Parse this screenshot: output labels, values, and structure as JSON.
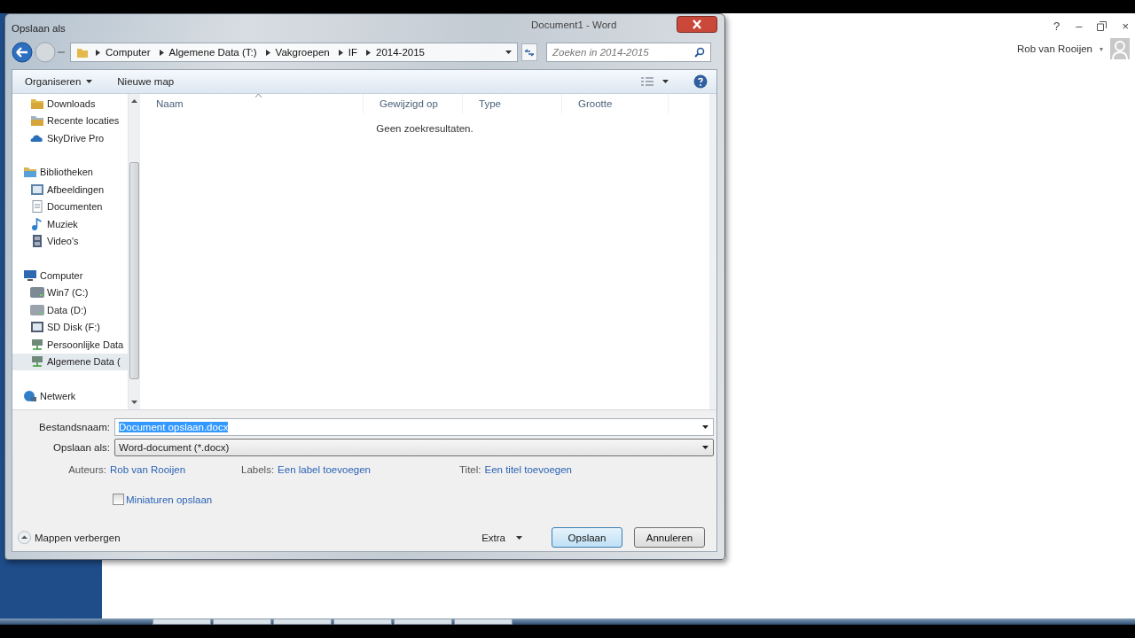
{
  "word_window": {
    "help": "?",
    "minimize": "–",
    "close": "×",
    "user": "Rob van Rooijen",
    "user_caret": "▾"
  },
  "dialog": {
    "title": "Opslaan als",
    "app_title": "Document1 - Word",
    "breadcrumbs": [
      "Computer",
      "Algemene Data (T:)",
      "Vakgroepen",
      "IF",
      "2014-2015"
    ],
    "search": {
      "placeholder": "Zoeken in 2014-2015"
    },
    "toolbar": {
      "organize": "Organiseren",
      "new_folder": "Nieuwe map"
    },
    "nav": [
      {
        "children": [
          {
            "label": "Downloads",
            "kind": "folder",
            "selected": false
          },
          {
            "label": "Recente locaties",
            "kind": "recent",
            "selected": false
          },
          {
            "label": "SkyDrive Pro",
            "kind": "cloud",
            "selected": false
          }
        ]
      },
      {
        "label": "Bibliotheken",
        "kind": "library",
        "selected": false,
        "children": [
          {
            "label": "Afbeeldingen",
            "kind": "pictures",
            "selected": false
          },
          {
            "label": "Documenten",
            "kind": "documents",
            "selected": false
          },
          {
            "label": "Muziek",
            "kind": "music",
            "selected": false
          },
          {
            "label": "Video's",
            "kind": "videos",
            "selected": false
          }
        ]
      },
      {
        "label": "Computer",
        "kind": "computer",
        "selected": false,
        "children": [
          {
            "label": "Win7 (C:)",
            "kind": "system_drive",
            "selected": false
          },
          {
            "label": "Data (D:)",
            "kind": "drive",
            "selected": false
          },
          {
            "label": "SD Disk (F:)",
            "kind": "sd",
            "selected": false
          },
          {
            "label": "Persoonlijke Data",
            "kind": "network_drive",
            "selected": false
          },
          {
            "label": "Algemene Data (",
            "kind": "network_drive",
            "selected": true
          }
        ]
      },
      {
        "label": "Netwerk",
        "kind": "network",
        "selected": false
      }
    ],
    "columns": [
      "Naam",
      "Gewijzigd op",
      "Type",
      "Grootte"
    ],
    "empty_message": "Geen zoekresultaten.",
    "filename": {
      "label": "Bestandsnaam:",
      "value": "Document opslaan.docx",
      "text_selected": true
    },
    "file_type": {
      "label": "Opslaan als:",
      "value": "Word-document (*.docx)"
    },
    "meta": [
      {
        "label": "Auteurs:",
        "value": "Rob van Rooijen"
      },
      {
        "label": "Labels:",
        "value": "Een label toevoegen"
      },
      {
        "label": "Titel:",
        "value": "Een titel toevoegen"
      }
    ],
    "thumbnails": {
      "label": "Miniaturen opslaan",
      "checked": false
    },
    "hide_folders": "Mappen verbergen",
    "extra": "Extra",
    "buttons": [
      {
        "label": "Opslaan",
        "default": true
      },
      {
        "label": "Annuleren",
        "default": false
      }
    ]
  }
}
